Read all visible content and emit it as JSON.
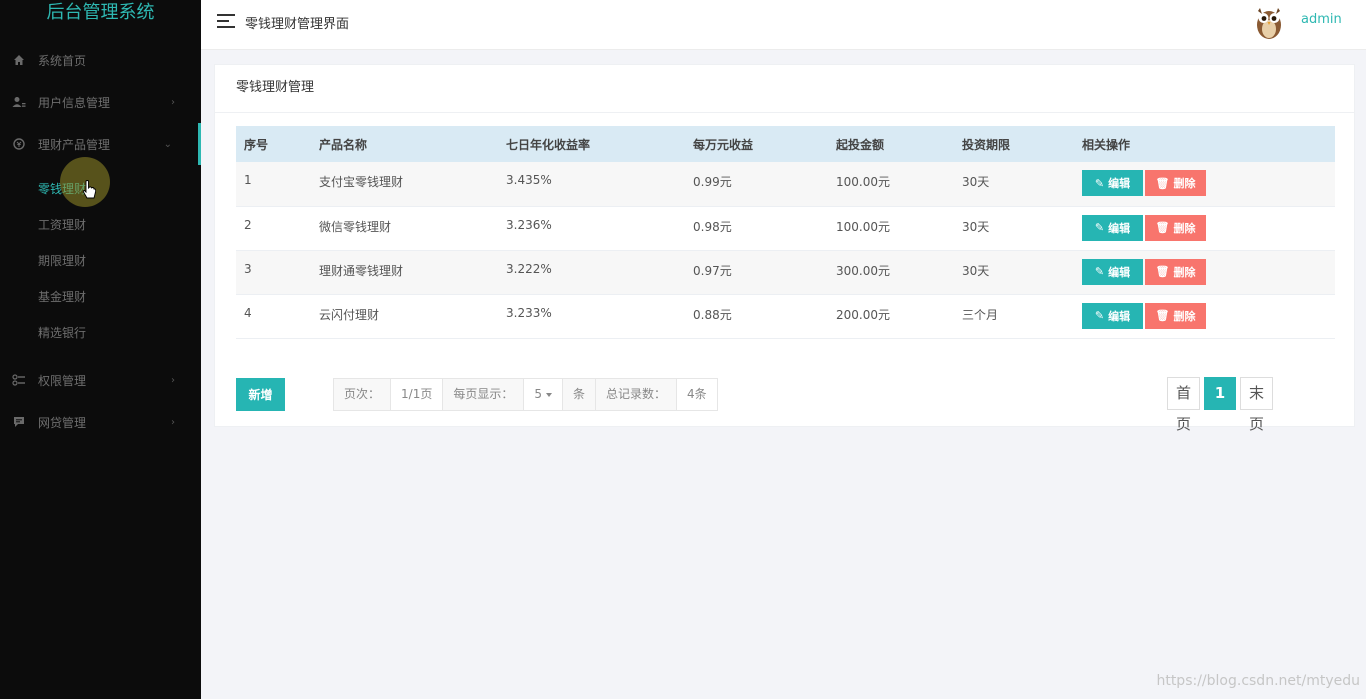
{
  "sidebar": {
    "brand": "后台管理系统",
    "menu": [
      {
        "label": "系统首页",
        "icon": "home-icon",
        "chevron": ""
      },
      {
        "label": "用户信息管理",
        "icon": "user-settings-icon",
        "chevron": "›"
      },
      {
        "label": "理财产品管理",
        "icon": "money-icon",
        "chevron": "⌄"
      }
    ],
    "submenu": [
      {
        "label": "零钱理财"
      },
      {
        "label": "工资理财"
      },
      {
        "label": "期限理财"
      },
      {
        "label": "基金理财"
      },
      {
        "label": "精选银行"
      }
    ],
    "menu_bottom": [
      {
        "label": "权限管理",
        "icon": "permission-icon",
        "chevron": "›"
      },
      {
        "label": "网贷管理",
        "icon": "chat-icon",
        "chevron": "›"
      }
    ]
  },
  "header": {
    "title": "零钱理财管理界面",
    "username": "admin"
  },
  "panel": {
    "title": "零钱理财管理",
    "columns": [
      "序号",
      "产品名称",
      "七日年化收益率",
      "每万元收益",
      "起投金额",
      "投资期限",
      "相关操作"
    ],
    "rows": [
      {
        "id": "1",
        "name": "支付宝零钱理财",
        "rate": "3.435%",
        "per10k": "0.99元",
        "min": "100.00元",
        "term": "30天"
      },
      {
        "id": "2",
        "name": "微信零钱理财",
        "rate": "3.236%",
        "per10k": "0.98元",
        "min": "100.00元",
        "term": "30天"
      },
      {
        "id": "3",
        "name": "理财通零钱理财",
        "rate": "3.222%",
        "per10k": "0.97元",
        "min": "300.00元",
        "term": "30天"
      },
      {
        "id": "4",
        "name": "云闪付理财",
        "rate": "3.233%",
        "per10k": "0.88元",
        "min": "200.00元",
        "term": "三个月"
      }
    ],
    "edit_label": "编辑",
    "delete_label": "删除",
    "add_label": "新增"
  },
  "pageinfo": {
    "page_label": "页次：",
    "page_value": "1/1页",
    "size_label": "每页显示：",
    "size_value": "5",
    "unit": "条",
    "total_label": "总记录数：",
    "total_value": "4条"
  },
  "pager": {
    "first": "首页",
    "current": "1",
    "last": "末页"
  },
  "watermark": "https://blog.csdn.net/mtyedu",
  "colors": {
    "accent": "#2eb8b2",
    "danger": "#f8756d",
    "sidebar_bg": "#0c0c0c"
  }
}
